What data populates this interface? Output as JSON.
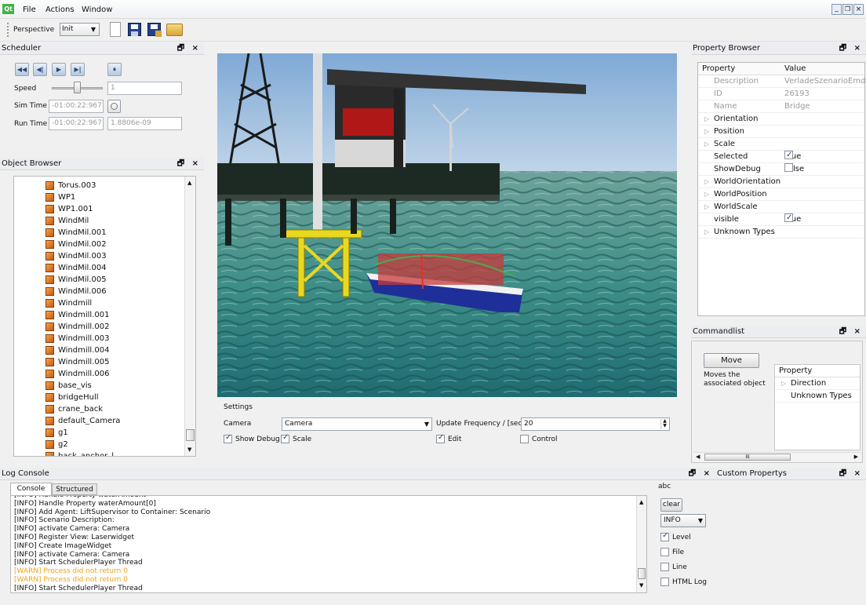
{
  "menu": {
    "logo": "Qt",
    "file": "File",
    "actions": "Actions",
    "window": "Window"
  },
  "window_controls": [
    "_",
    "❐",
    "×"
  ],
  "toolbar": {
    "perspective_label": "Perspective",
    "perspective_value": "Init"
  },
  "scheduler": {
    "title": "Scheduler",
    "buttons": [
      "◀◀",
      "◀|",
      "▶",
      "▶|",
      "⏸"
    ],
    "speed_label": "Speed",
    "speed_value": "1",
    "sim_time_label": "Sim Time",
    "sim_time_value": "-01:00:22:967",
    "run_time_label": "Run Time",
    "run_time_value": "-01:00:22:967",
    "run_time_extra": "1.8806e-09"
  },
  "object_browser": {
    "title": "Object Browser",
    "items": [
      "Torus.003",
      "WP1",
      "WP1.001",
      "WindMil",
      "WindMil.001",
      "WindMil.002",
      "WindMil.003",
      "WindMil.004",
      "WindMil.005",
      "WindMil.006",
      "Windmill",
      "Windmill.001",
      "Windmill.002",
      "Windmill.003",
      "Windmill.004",
      "Windmill.005",
      "Windmill.006",
      "base_vis",
      "bridgeHull",
      "crane_back",
      "default_Camera",
      "g1",
      "g2",
      "back_anchor_l"
    ]
  },
  "settings": {
    "title": "Settings",
    "camera_label": "Camera",
    "camera_value": "Camera",
    "update_label": "Update Frequency / [sec]",
    "update_value": "20",
    "show_debug": "Show Debug",
    "scale": "Scale",
    "edit": "Edit",
    "control": "Control"
  },
  "property_browser": {
    "title": "Property Browser",
    "col_property": "Property",
    "col_value": "Value",
    "rows": [
      {
        "name": "Description",
        "value": "VerladeSzenarioEmd..."
      },
      {
        "name": "ID",
        "value": "26193"
      },
      {
        "name": "Name",
        "value": "Bridge"
      },
      {
        "name": "Orientation",
        "value": ""
      },
      {
        "name": "Position",
        "value": ""
      },
      {
        "name": "Scale",
        "value": ""
      },
      {
        "name": "Selected",
        "value": "True"
      },
      {
        "name": "ShowDebug",
        "value": "False"
      },
      {
        "name": "WorldOrientation",
        "value": ""
      },
      {
        "name": "WorldPosition",
        "value": ""
      },
      {
        "name": "WorldScale",
        "value": ""
      },
      {
        "name": "visible",
        "value": "True"
      },
      {
        "name": "Unknown Types",
        "value": ""
      }
    ]
  },
  "commandlist": {
    "title": "Commandlist",
    "move_button": "Move",
    "move_desc": "Moves the associated object",
    "col_property": "Property",
    "rows": [
      "Direction",
      "Unknown Types"
    ],
    "scroll_mid": "III"
  },
  "log_console": {
    "title": "Log Console",
    "tab_console": "Console",
    "tab_structured": "Structured",
    "lines": [
      {
        "text": "[INFO] Handle Property waterAmount",
        "level": "info"
      },
      {
        "text": "[INFO] Handle Property waterAmount[0]",
        "level": "info"
      },
      {
        "text": "[INFO] Add Agent: LiftSupervisor to Container: Scenario",
        "level": "info"
      },
      {
        "text": "[INFO] Scenario Description:",
        "level": "info"
      },
      {
        "text": "[INFO] activate Camera: Camera",
        "level": "info"
      },
      {
        "text": "[INFO] Register View: Laserwidget",
        "level": "info"
      },
      {
        "text": "[INFO] Create ImageWidget",
        "level": "info"
      },
      {
        "text": "[INFO] activate Camera: Camera",
        "level": "info"
      },
      {
        "text": "[INFO] Start SchedulerPlayer Thread",
        "level": "info"
      },
      {
        "text": "[WARN] Process did not return 0",
        "level": "warn"
      },
      {
        "text": "[WARN] Process did not return 0",
        "level": "warn"
      },
      {
        "text": "[INFO] Start SchedulerPlayer Thread",
        "level": "info"
      }
    ],
    "side_label": "abc",
    "clear": "clear",
    "level_value": "INFO",
    "opt_level": "Level",
    "opt_file": "File",
    "opt_line": "Line",
    "opt_html": "HTML Log"
  },
  "custom_props": {
    "title": "Custom Propertys"
  },
  "dock_buttons": "🗗 ×"
}
